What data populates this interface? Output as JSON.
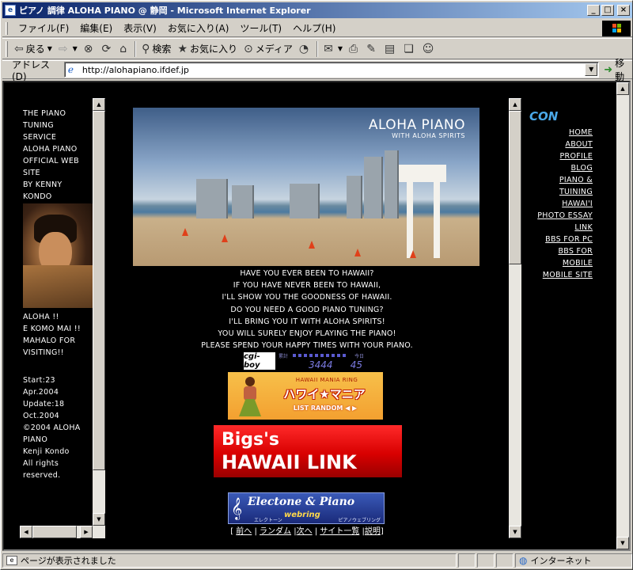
{
  "window": {
    "title": "ピアノ 調律 ALOHA PIANO @ 静岡 - Microsoft Internet Explorer",
    "controls": [
      "_",
      "□",
      "×"
    ]
  },
  "menu": [
    "ファイル(F)",
    "編集(E)",
    "表示(V)",
    "お気に入り(A)",
    "ツール(T)",
    "ヘルプ(H)"
  ],
  "toolbar": {
    "back": "戻る",
    "search": "検索",
    "favorites": "お気に入り",
    "media": "メディア"
  },
  "address": {
    "label": "アドレス(D)",
    "url": "http://alohapiano.ifdef.jp",
    "go": "移動"
  },
  "left_frame": {
    "intro_lines": [
      "THE PIANO",
      "TUNING",
      "SERVICE",
      "ALOHA PIANO",
      "OFFICIAL WEB",
      "SITE",
      "BY KENNY",
      "KONDO"
    ],
    "greeting_lines": [
      "ALOHA !!",
      "E KOMO MAI !!",
      "MAHALO FOR",
      "VISITING!!"
    ],
    "footer_lines": [
      "Start:23",
      "Apr.2004",
      "Update:18",
      "Oct.2004",
      "©2004 ALOHA",
      "PIANO",
      "Kenji Kondo",
      "All rights",
      "reserved."
    ]
  },
  "main": {
    "hero_title": "ALOHA PIANO",
    "hero_subtitle": "WITH ALOHA SPIRITS",
    "intro_lines": [
      "HAVE YOU EVER BEEN TO HAWAII?",
      "IF YOU HAVE NEVER BEEN TO  HAWAII,",
      "I'LL SHOW YOU THE GOODNESS OF HAWAII.",
      "DO YOU NEED A GOOD PIANO TUNING?",
      "I'LL BRING YOU IT WITH ALOHA SPIRITS!",
      "YOU WILL SURELY ENJOY PLAYING THE PIANO!",
      "PLEASE SPEND YOUR HAPPY TIMES WITH YOUR PIANO."
    ],
    "counter": {
      "badge": "cgi-boy",
      "total_label": "累計",
      "today_label": "今日",
      "total": "3444",
      "today": "45"
    },
    "banner_hawaii_mania": {
      "top": "HAWAII MANIA RING",
      "title": "ハワイ★マニア",
      "bottom": "LIST RANDOM ◀ ▶"
    },
    "banner_bigs": {
      "line1": "Bigs's",
      "line2": "HAWAII LINK"
    },
    "banner_electone": {
      "title": "Electone & Piano",
      "sub": "webring",
      "jp_left": "エレクトーン",
      "jp_right": "ピアノウェブリング"
    },
    "webring_nav": [
      "前へ",
      "ランダム",
      "次へ",
      "サイト一覧",
      "説明"
    ]
  },
  "right_nav": {
    "label": "CON",
    "links": [
      "HOME",
      "ABOUT",
      "PROFILE",
      "BLOG",
      "PIANO &",
      "TUINING",
      "HAWAI'I",
      "PHOTO ESSAY",
      "LINK",
      "BBS FOR PC",
      "BBS FOR",
      "MOBILE",
      "MOBILE SITE"
    ]
  },
  "status": {
    "text": "ページが表示されました",
    "zone": "インターネット"
  },
  "colors": {
    "titlebar_start": "#0a246a",
    "titlebar_end": "#a6caf0",
    "page_bg": "#000000",
    "con_accent": "#4aa8e8"
  }
}
